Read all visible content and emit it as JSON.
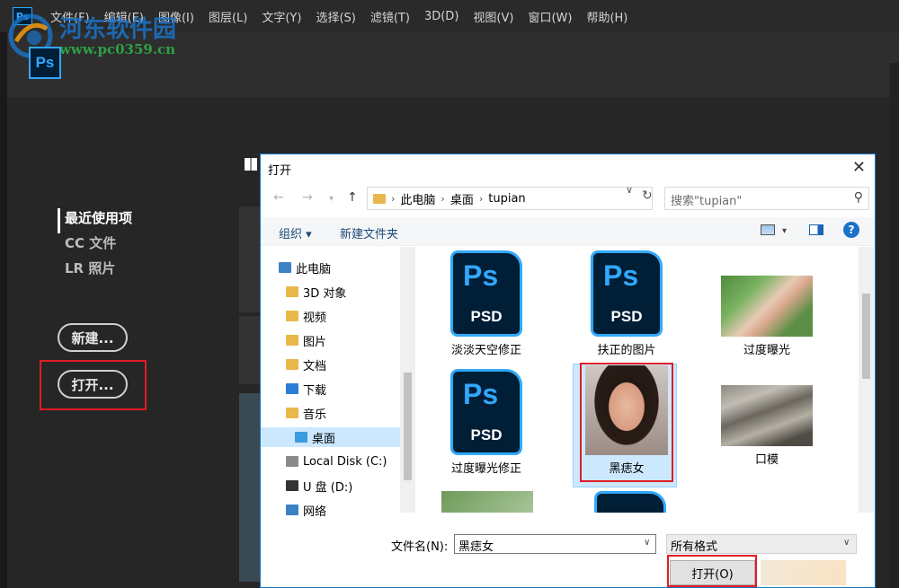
{
  "menubar": {
    "items": [
      "文件(F)",
      "编辑(E)",
      "图像(I)",
      "图层(L)",
      "文字(Y)",
      "选择(S)",
      "滤镜(T)",
      "3D(D)",
      "视图(V)",
      "窗口(W)",
      "帮助(H)"
    ]
  },
  "app": {
    "ps_logo": "Ps",
    "nav": [
      "最近使用项",
      "CC 文件",
      "LR 照片"
    ],
    "new_button": "新建...",
    "open_button": "打开..."
  },
  "watermark": {
    "site_name": "河东软件园",
    "url": "www.pc0359.cn"
  },
  "dialog": {
    "title": "打开",
    "close": "✕",
    "breadcrumb": [
      "此电脑",
      "桌面",
      "tupian"
    ],
    "search_placeholder": "搜索\"tupian\"",
    "toolbar": {
      "organize": "组织 ▾",
      "new_folder": "新建文件夹",
      "help": "?"
    },
    "nav_pane": [
      {
        "label": "此电脑",
        "icon": "computer-icon"
      },
      {
        "label": "3D 对象",
        "icon": "folder-icon"
      },
      {
        "label": "视频",
        "icon": "video-folder-icon"
      },
      {
        "label": "图片",
        "icon": "pictures-folder-icon"
      },
      {
        "label": "文档",
        "icon": "documents-folder-icon"
      },
      {
        "label": "下载",
        "icon": "downloads-folder-icon"
      },
      {
        "label": "音乐",
        "icon": "music-folder-icon"
      },
      {
        "label": "桌面",
        "icon": "desktop-folder-icon"
      },
      {
        "label": "Local Disk (C:)",
        "icon": "drive-icon"
      },
      {
        "label": "U 盘 (D:)",
        "icon": "usb-drive-icon"
      },
      {
        "label": "网络",
        "icon": "network-icon"
      }
    ],
    "files": [
      {
        "name": "淡淡天空修正",
        "kind": "psd"
      },
      {
        "name": "扶正的图片",
        "kind": "psd"
      },
      {
        "name": "过度曝光",
        "kind": "photo"
      },
      {
        "name": "过度曝光修正",
        "kind": "psd"
      },
      {
        "name": "黑痣女",
        "kind": "photo"
      },
      {
        "name": "口模",
        "kind": "photo"
      }
    ],
    "psd_badge": "PSD",
    "ps_badge": "Ps",
    "filename_label": "文件名(N):",
    "filename_value": "黑痣女",
    "filter_value": "所有格式",
    "open_button": "打开(O)"
  },
  "colors": {
    "accent": "#1979ca",
    "highlight_box": "#e01b24",
    "ps_blue": "#31a8ff"
  }
}
